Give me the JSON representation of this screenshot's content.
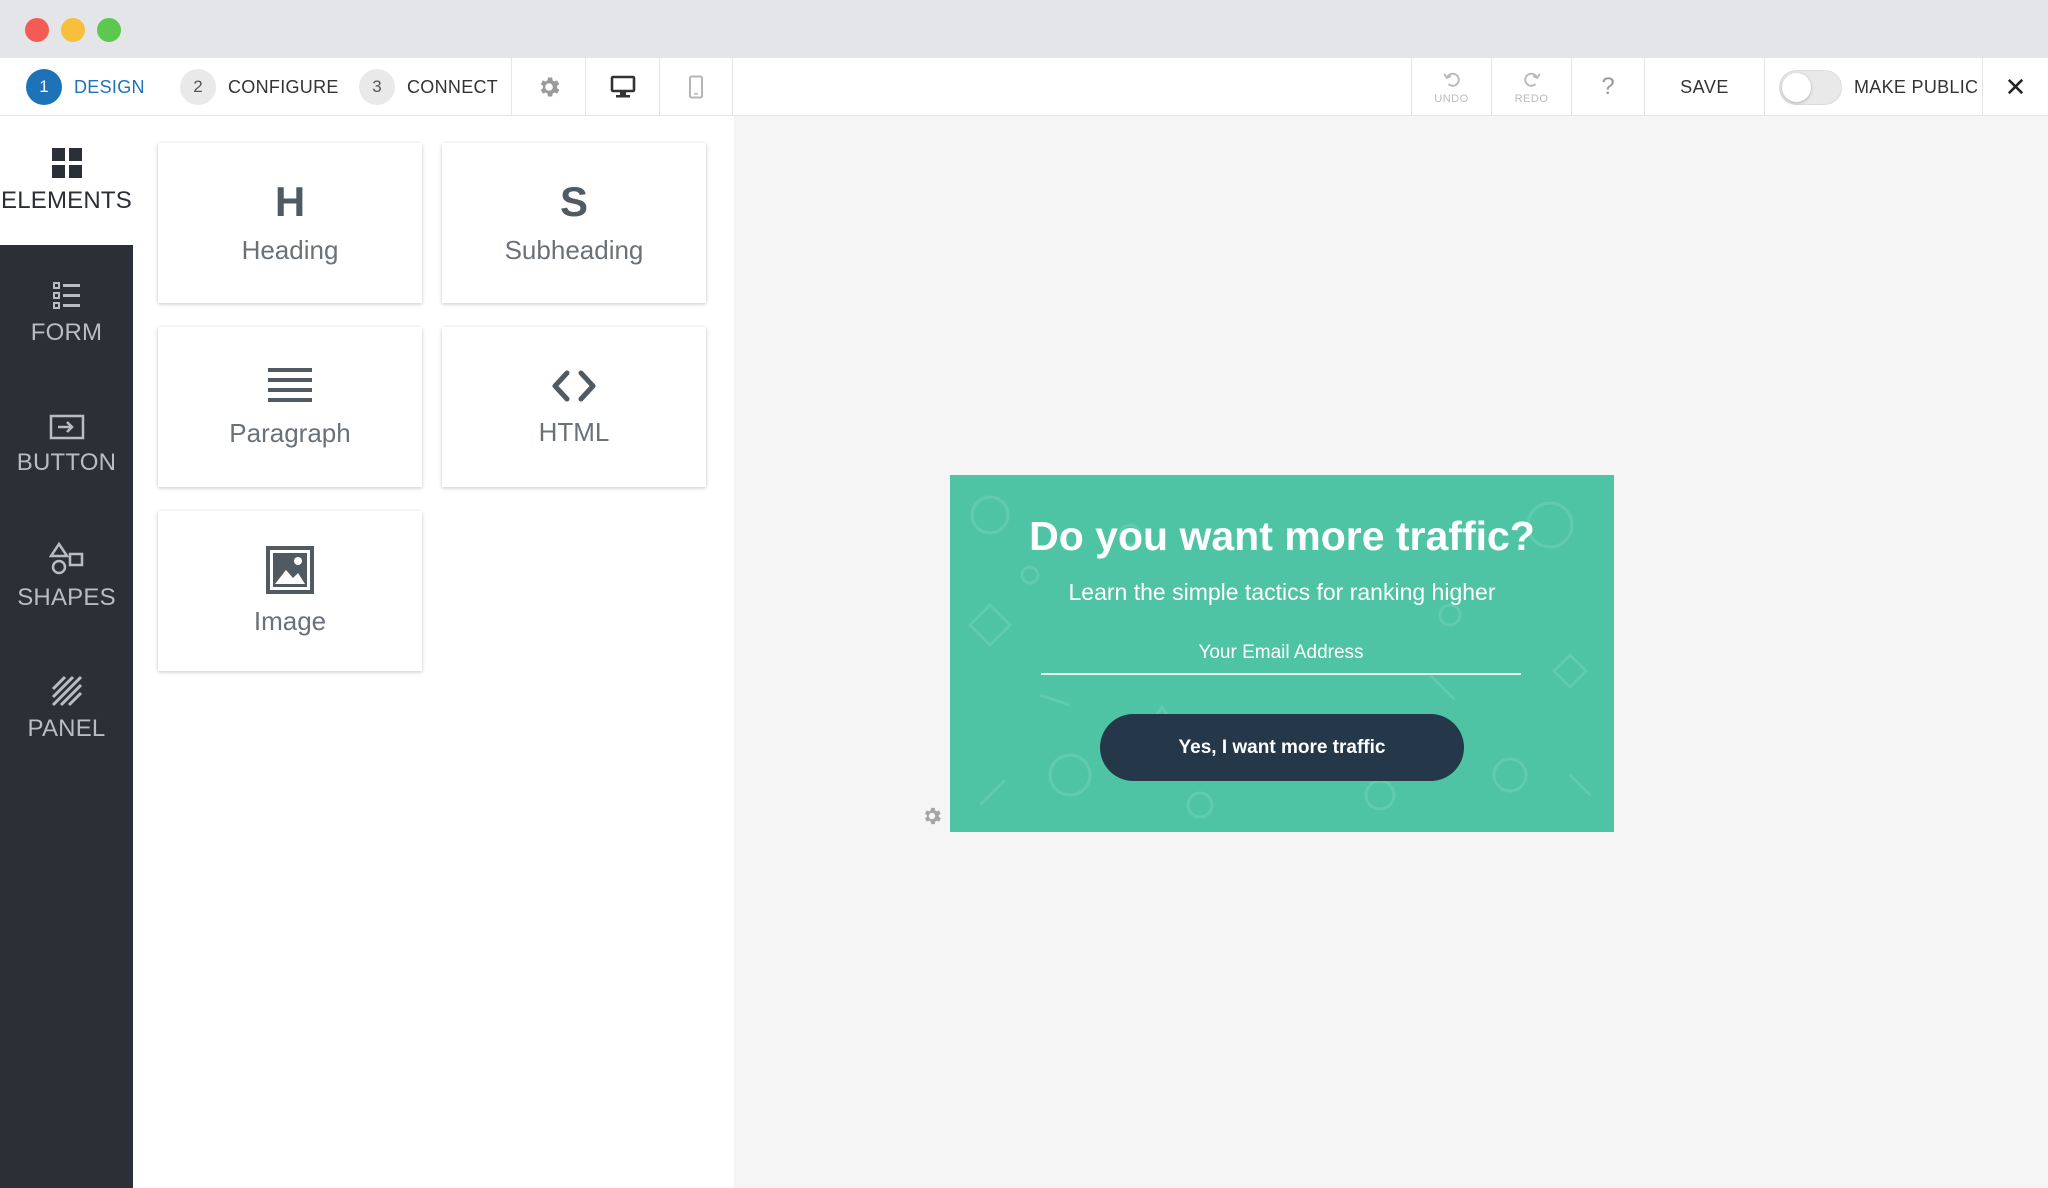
{
  "steps": [
    {
      "num": "1",
      "label": "DESIGN"
    },
    {
      "num": "2",
      "label": "CONFIGURE"
    },
    {
      "num": "3",
      "label": "CONNECT"
    }
  ],
  "toolbar": {
    "undo_label": "UNDO",
    "redo_label": "REDO",
    "help_label": "?",
    "save_label": "SAVE",
    "make_public_label": "MAKE PUBLIC",
    "close_label": "✕"
  },
  "sidebar": {
    "items": [
      {
        "label": "ELEMENTS",
        "icon": "grid-icon"
      },
      {
        "label": "FORM",
        "icon": "list-icon"
      },
      {
        "label": "BUTTON",
        "icon": "button-icon"
      },
      {
        "label": "SHAPES",
        "icon": "shapes-icon"
      },
      {
        "label": "PANEL",
        "icon": "panel-icon"
      }
    ]
  },
  "elements": [
    {
      "glyph": "H",
      "label": "Heading"
    },
    {
      "glyph": "S",
      "label": "Subheading"
    },
    {
      "label": "Paragraph",
      "icon": "paragraph-icon"
    },
    {
      "label": "HTML",
      "icon": "code-icon"
    },
    {
      "label": "Image",
      "icon": "image-icon"
    }
  ],
  "optin": {
    "title": "Do you want more traffic?",
    "subtitle": "Learn the simple tactics for ranking higher",
    "email_placeholder": "Your Email Address",
    "button_label": "Yes, I want more traffic",
    "background_color": "#4fc4a4",
    "button_color": "#25384a"
  },
  "colors": {
    "accent": "#1e73b8",
    "sidebar_bg": "#2b2f36"
  }
}
